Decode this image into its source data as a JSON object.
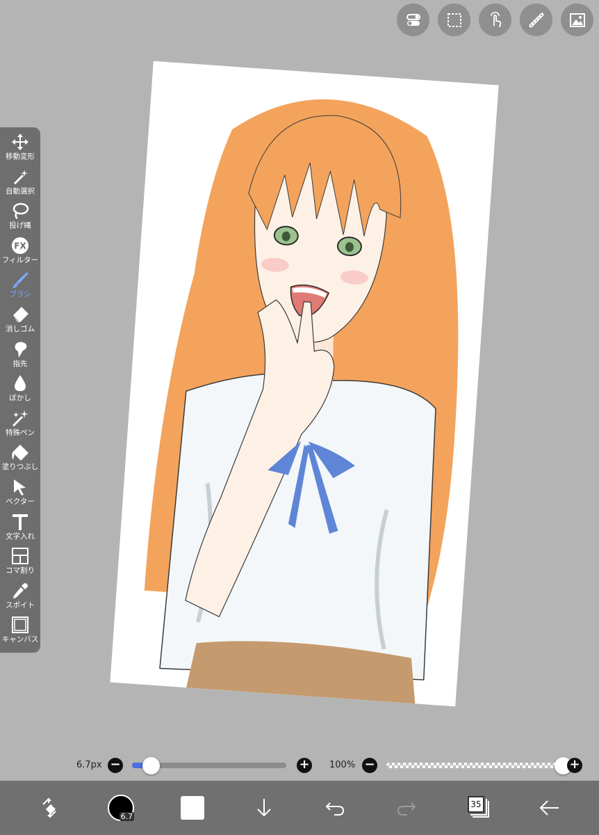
{
  "top_toolbar": {
    "items": [
      {
        "icon": "toggle-icon"
      },
      {
        "icon": "selection-icon"
      },
      {
        "icon": "touch-gesture-icon"
      },
      {
        "icon": "ruler-icon"
      },
      {
        "icon": "material-icon"
      }
    ]
  },
  "tool_panel": {
    "items": [
      {
        "label": "移動変形",
        "icon": "move-transform-icon"
      },
      {
        "label": "自動選択",
        "icon": "magic-wand-icon"
      },
      {
        "label": "投げ縄",
        "icon": "lasso-icon"
      },
      {
        "label": "フィルター",
        "icon": "fx-filter-icon"
      },
      {
        "label": "ブラシ",
        "icon": "brush-icon",
        "active": true
      },
      {
        "label": "消しゴム",
        "icon": "eraser-icon"
      },
      {
        "label": "指先",
        "icon": "smudge-icon"
      },
      {
        "label": "ぼかし",
        "icon": "blur-drop-icon"
      },
      {
        "label": "特殊ペン",
        "icon": "sparkle-pen-icon"
      },
      {
        "label": "塗りつぶし",
        "icon": "bucket-fill-icon"
      },
      {
        "label": "ベクター",
        "icon": "vector-cursor-icon"
      },
      {
        "label": "文字入れ",
        "icon": "text-icon"
      },
      {
        "label": "コマ割り",
        "icon": "frame-divider-icon"
      },
      {
        "label": "スポイト",
        "icon": "eyedropper-icon"
      },
      {
        "label": "キャンバス",
        "icon": "canvas-icon"
      }
    ],
    "active_color": "#7fa8ff"
  },
  "brush_size": {
    "label": "6.7px",
    "level": 0.12,
    "minus": "−",
    "plus": "+"
  },
  "opacity": {
    "label": "100%",
    "level": 1.0,
    "minus": "−",
    "plus": "+"
  },
  "bottom_bar": {
    "brush_size_badge": "6.7",
    "layer_count": "35",
    "primary_color": "#ffffff",
    "items": [
      {
        "icon": "swap-transform-icon"
      },
      {
        "icon": "brush-size-icon"
      },
      {
        "icon": "color-swatch-icon"
      },
      {
        "icon": "import-arrow-icon"
      },
      {
        "icon": "undo-icon"
      },
      {
        "icon": "redo-icon"
      },
      {
        "icon": "layers-icon"
      },
      {
        "icon": "back-arrow-icon"
      }
    ]
  },
  "colors": {
    "background": "#b4b4b4",
    "panel": "#6e6e6e",
    "bottom_bar": "#707070",
    "accent": "#4a6fe0"
  }
}
